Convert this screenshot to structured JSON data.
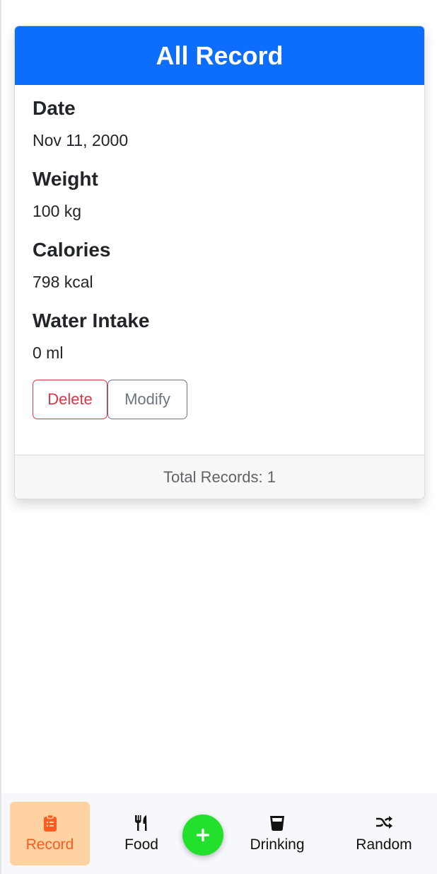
{
  "card": {
    "title": "All Record",
    "fields": [
      {
        "label": "Date",
        "value": "Nov 11, 2000"
      },
      {
        "label": "Weight",
        "value": "100 kg"
      },
      {
        "label": "Calories",
        "value": "798 kcal"
      },
      {
        "label": "Water Intake",
        "value": "0 ml"
      }
    ],
    "actions": {
      "delete_label": "Delete",
      "modify_label": "Modify"
    },
    "footer": "Total Records: 1"
  },
  "bottom_nav": {
    "items": [
      {
        "label": "Record",
        "icon": "clipboard-list-icon",
        "active": true
      },
      {
        "label": "Food",
        "icon": "utensils-icon",
        "active": false
      },
      {
        "label": "Drinking",
        "icon": "glass-icon",
        "active": false
      },
      {
        "label": "Random",
        "icon": "shuffle-icon",
        "active": false
      }
    ],
    "fab_icon": "plus-icon"
  },
  "colors": {
    "primary": "#0d6efd",
    "danger": "#dc3545",
    "secondary": "#6c757d",
    "active_nav_bg": "#ffd3a1",
    "active_nav_text": "#ff5a1f",
    "fab": "#22e02c"
  }
}
